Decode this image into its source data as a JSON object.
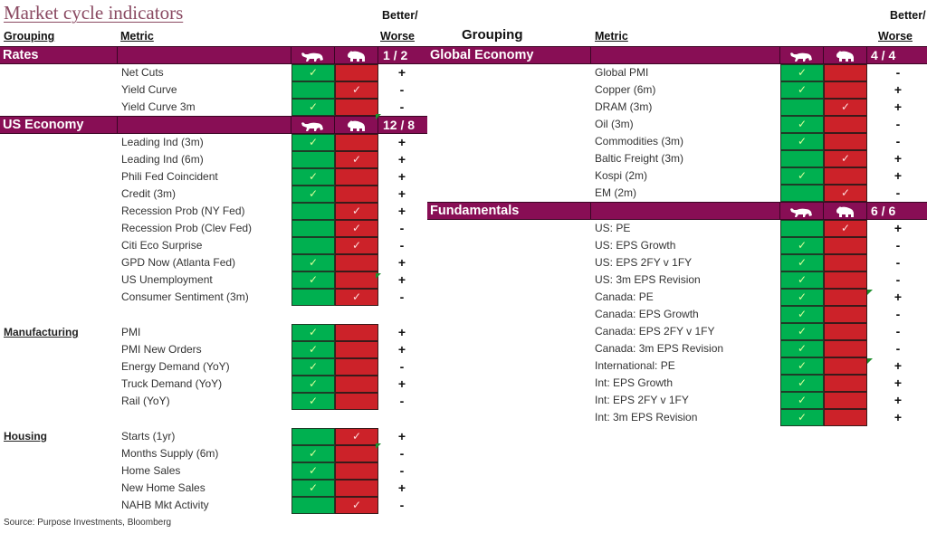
{
  "title": "Market cycle indicators",
  "headers": {
    "grouping": "Grouping",
    "metric": "Metric",
    "better": "Better/",
    "worse": "Worse"
  },
  "icons": {
    "bull": "bull-icon",
    "bear": "bear-icon",
    "check": "✓"
  },
  "colors": {
    "band": "#880e55",
    "bull_cell": "#00b050",
    "bear_cell": "#cc2229",
    "title": "#8a4a62"
  },
  "left": {
    "sections": [
      {
        "name": "Rates",
        "score": "1 / 2",
        "band": true,
        "rows": [
          {
            "metric": "Net Cuts",
            "signal": "bull",
            "trend": "+"
          },
          {
            "metric": "Yield Curve",
            "signal": "bear",
            "trend": "-"
          },
          {
            "metric": "Yield Curve 3m",
            "signal": "bull",
            "trend": "-"
          }
        ]
      },
      {
        "name": "US Economy",
        "score": "12 / 8",
        "band": true,
        "rows": [
          {
            "metric": "Leading Ind (3m)",
            "signal": "bull",
            "trend": "+"
          },
          {
            "metric": "Leading Ind (6m)",
            "signal": "bear",
            "trend": "+"
          },
          {
            "metric": "Phili Fed Coincident",
            "signal": "bull",
            "trend": "+"
          },
          {
            "metric": "Credit (3m)",
            "signal": "bull",
            "trend": "+"
          },
          {
            "metric": "Recession Prob (NY Fed)",
            "signal": "bear",
            "trend": "+"
          },
          {
            "metric": "Recession Prob (Clev Fed)",
            "signal": "bear",
            "trend": "-"
          },
          {
            "metric": "Citi Eco Surprise",
            "signal": "bear",
            "trend": "-"
          },
          {
            "metric": "GPD Now (Atlanta Fed)",
            "signal": "bull",
            "trend": "+"
          },
          {
            "metric": "US Unemployment",
            "signal": "bull",
            "trend": "+"
          },
          {
            "metric": "Consumer Sentiment (3m)",
            "signal": "bear",
            "trend": "-"
          }
        ]
      },
      {
        "name": "Manufacturing",
        "band": false,
        "rows": [
          {
            "metric": "PMI",
            "signal": "bull",
            "trend": "+"
          },
          {
            "metric": "PMI New Orders",
            "signal": "bull",
            "trend": "+"
          },
          {
            "metric": "Energy Demand (YoY)",
            "signal": "bull",
            "trend": "-"
          },
          {
            "metric": "Truck Demand (YoY)",
            "signal": "bull",
            "trend": "+"
          },
          {
            "metric": "Rail (YoY)",
            "signal": "bull",
            "trend": "-"
          }
        ]
      },
      {
        "name": "Housing",
        "band": false,
        "rows": [
          {
            "metric": "Starts (1yr)",
            "signal": "bear",
            "trend": "+"
          },
          {
            "metric": "Months Supply (6m)",
            "signal": "bull",
            "trend": "-"
          },
          {
            "metric": "Home Sales",
            "signal": "bull",
            "trend": "-"
          },
          {
            "metric": "New Home Sales",
            "signal": "bull",
            "trend": "+"
          },
          {
            "metric": "NAHB Mkt Activity",
            "signal": "bear",
            "trend": "-"
          }
        ]
      }
    ]
  },
  "right": {
    "sections": [
      {
        "name": "Global Economy",
        "score": "4 / 4",
        "band": true,
        "rows": [
          {
            "metric": "Global PMI",
            "signal": "bull",
            "trend": "-"
          },
          {
            "metric": "Copper (6m)",
            "signal": "bull",
            "trend": "+"
          },
          {
            "metric": "DRAM (3m)",
            "signal": "bear",
            "trend": "+"
          },
          {
            "metric": "Oil (3m)",
            "signal": "bull",
            "trend": "-"
          },
          {
            "metric": "Commodities (3m)",
            "signal": "bull",
            "trend": "-"
          },
          {
            "metric": "Baltic Freight (3m)",
            "signal": "bear",
            "trend": "+"
          },
          {
            "metric": "Kospi (2m)",
            "signal": "bull",
            "trend": "+"
          },
          {
            "metric": "EM (2m)",
            "signal": "bear",
            "trend": "-"
          }
        ]
      },
      {
        "name": "Fundamentals",
        "score": "6 / 6",
        "band": true,
        "rows": [
          {
            "metric": "US: PE",
            "signal": "bear",
            "trend": "+"
          },
          {
            "metric": "US: EPS Growth",
            "signal": "bull",
            "trend": "-"
          },
          {
            "metric": "US: EPS 2FY v 1FY",
            "signal": "bull",
            "trend": "-"
          },
          {
            "metric": "US: 3m EPS Revision",
            "signal": "bull",
            "trend": "-"
          },
          {
            "metric": "Canada: PE",
            "signal": "bull",
            "trend": "+"
          },
          {
            "metric": "Canada: EPS Growth",
            "signal": "bull",
            "trend": "-"
          },
          {
            "metric": "Canada: EPS 2FY v 1FY",
            "signal": "bull",
            "trend": "-"
          },
          {
            "metric": "Canada: 3m EPS Revision",
            "signal": "bull",
            "trend": "-"
          },
          {
            "metric": "International: PE",
            "signal": "bull",
            "trend": "+"
          },
          {
            "metric": "Int: EPS Growth",
            "signal": "bull",
            "trend": "+"
          },
          {
            "metric": "Int: EPS 2FY v 1FY",
            "signal": "bull",
            "trend": "+"
          },
          {
            "metric": "Int: 3m EPS Revision",
            "signal": "bull",
            "trend": "+"
          }
        ]
      }
    ]
  },
  "source": "Source: Purpose Investments, Bloomberg"
}
